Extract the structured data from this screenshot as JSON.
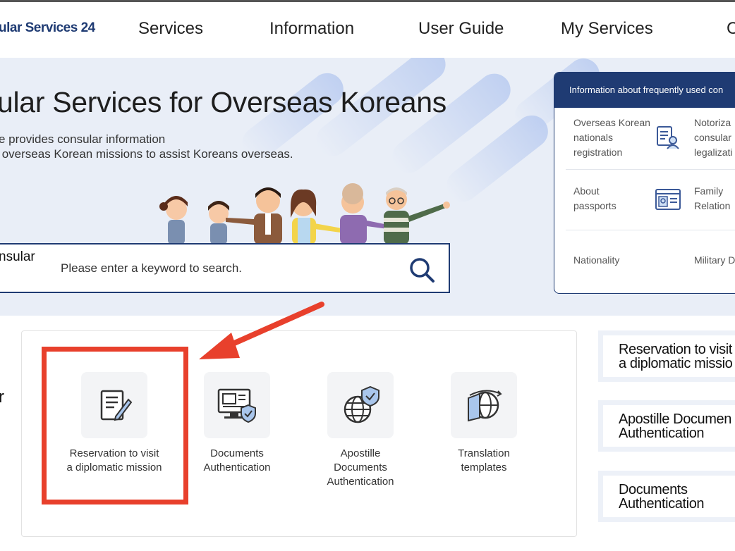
{
  "header": {
    "logo_text": "ular Services 24",
    "nav": [
      {
        "label": "Services"
      },
      {
        "label": "Information"
      },
      {
        "label": "User Guide"
      },
      {
        "label": "My Services"
      }
    ],
    "nav_cut_label": "C"
  },
  "hero": {
    "title": "ular Services for Overseas Koreans",
    "subtitle": "e provides consular information\n overseas Korean missions to assist Koreans overseas."
  },
  "search": {
    "label": "nsular",
    "placeholder": "Please enter a keyword to search.",
    "icon": "search-icon"
  },
  "info_panel": {
    "heading": "Information about frequently used con",
    "items": [
      {
        "label": "Overseas Korean\nnationals\nregistration",
        "icon": "registration-document-icon"
      },
      {
        "label": "Notoriza\nconsular\nlegalizati",
        "icon": ""
      },
      {
        "label": "About\npassports",
        "icon": "passport-icon"
      },
      {
        "label": "Family\nRelation",
        "icon": ""
      },
      {
        "label": "Nationality",
        "icon": ""
      },
      {
        "label": "Military D",
        "icon": ""
      }
    ]
  },
  "main": {
    "left_cut": "r",
    "services": [
      {
        "label": "Reservation to visit\na diplomatic mission",
        "icon": "edit-document-icon"
      },
      {
        "label": "Documents\nAuthentication",
        "icon": "monitor-shield-icon"
      },
      {
        "label": "Apostille\nDocuments\nAuthentication",
        "icon": "globe-shield-icon"
      },
      {
        "label": "Translation\ntemplates",
        "icon": "globe-translate-icon"
      }
    ]
  },
  "side_buttons": [
    {
      "label": "Reservation to visit\na diplomatic missio"
    },
    {
      "label": "Apostille Documen\nAuthentication"
    },
    {
      "label": "Documents\nAuthentication"
    }
  ],
  "colors": {
    "brand_navy": "#1f3b73",
    "hero_bg": "#e9eef7",
    "highlight_red": "#e8402c"
  }
}
